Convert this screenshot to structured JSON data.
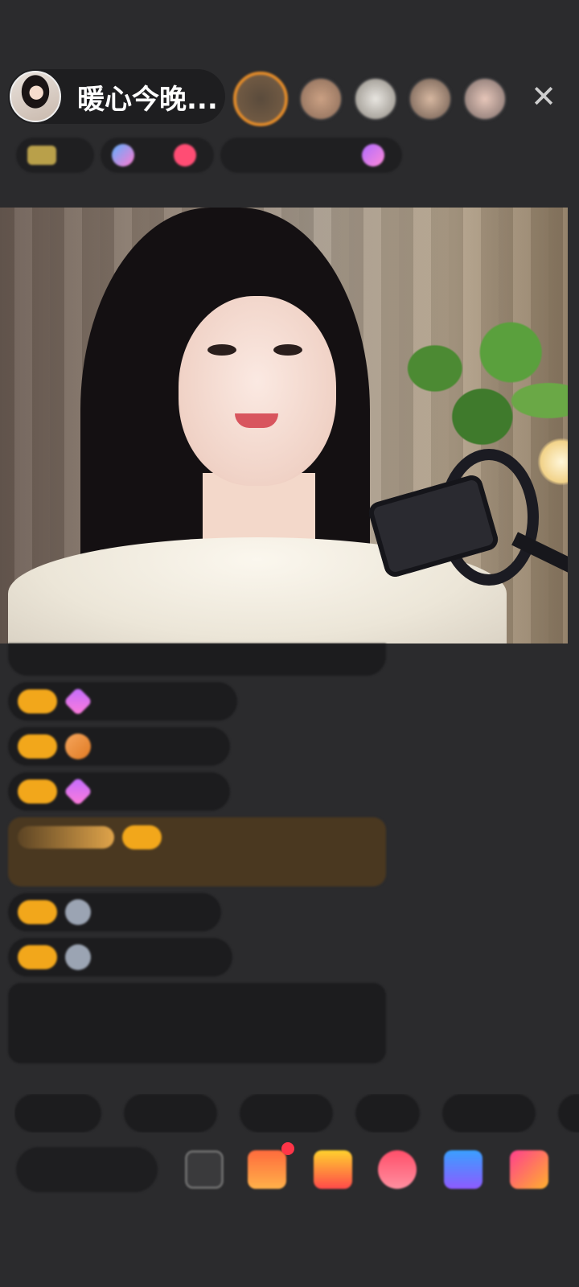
{
  "header": {
    "host_name": "暖心今晚...",
    "close_symbol": "✕",
    "viewer_count": 5
  },
  "info_strip": {
    "items": [
      "",
      "",
      "",
      "",
      ""
    ]
  },
  "colors": {
    "badge_gold": "#f2a71b",
    "notice_green": "#a7d07f",
    "accent_orange": "#e08a2a",
    "background": "#2b2b2d"
  },
  "icons": {
    "close": "close-icon",
    "gift": "gift-icon",
    "more": "more-icon"
  }
}
